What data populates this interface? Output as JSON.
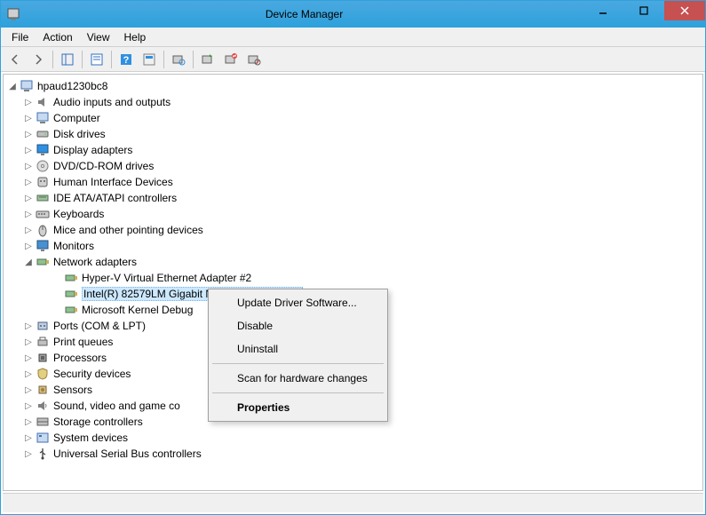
{
  "window": {
    "title": "Device Manager"
  },
  "menubar": {
    "items": [
      "File",
      "Action",
      "View",
      "Help"
    ]
  },
  "tree": {
    "root": "hpaud1230bc8",
    "categories": [
      {
        "label": "Audio inputs and outputs",
        "icon": "audio",
        "expanded": false
      },
      {
        "label": "Computer",
        "icon": "computer",
        "expanded": false
      },
      {
        "label": "Disk drives",
        "icon": "disk",
        "expanded": false
      },
      {
        "label": "Display adapters",
        "icon": "display",
        "expanded": false
      },
      {
        "label": "DVD/CD-ROM drives",
        "icon": "dvd",
        "expanded": false
      },
      {
        "label": "Human Interface Devices",
        "icon": "hid",
        "expanded": false
      },
      {
        "label": "IDE ATA/ATAPI controllers",
        "icon": "ide",
        "expanded": false
      },
      {
        "label": "Keyboards",
        "icon": "keyboard",
        "expanded": false
      },
      {
        "label": "Mice and other pointing devices",
        "icon": "mouse",
        "expanded": false
      },
      {
        "label": "Monitors",
        "icon": "monitor",
        "expanded": false
      },
      {
        "label": "Network adapters",
        "icon": "network",
        "expanded": true,
        "children": [
          {
            "label": "Hyper-V Virtual Ethernet Adapter #2",
            "icon": "network"
          },
          {
            "label": "Intel(R) 82579LM Gigabit Network Connection",
            "icon": "network",
            "selected": true
          },
          {
            "label": "Microsoft Kernel Debug",
            "icon": "network",
            "truncated": true
          }
        ]
      },
      {
        "label": "Ports (COM & LPT)",
        "icon": "port",
        "expanded": false
      },
      {
        "label": "Print queues",
        "icon": "printer",
        "expanded": false
      },
      {
        "label": "Processors",
        "icon": "cpu",
        "expanded": false
      },
      {
        "label": "Security devices",
        "icon": "security",
        "expanded": false
      },
      {
        "label": "Sensors",
        "icon": "sensor",
        "expanded": false
      },
      {
        "label": "Sound, video and game co",
        "icon": "sound",
        "expanded": false,
        "truncated": true
      },
      {
        "label": "Storage controllers",
        "icon": "storage",
        "expanded": false
      },
      {
        "label": "System devices",
        "icon": "system",
        "expanded": false
      },
      {
        "label": "Universal Serial Bus controllers",
        "icon": "usb",
        "expanded": false
      }
    ]
  },
  "context_menu": {
    "items": [
      {
        "label": "Update Driver Software...",
        "type": "item"
      },
      {
        "label": "Disable",
        "type": "item"
      },
      {
        "label": "Uninstall",
        "type": "item"
      },
      {
        "type": "separator"
      },
      {
        "label": "Scan for hardware changes",
        "type": "item"
      },
      {
        "type": "separator"
      },
      {
        "label": "Properties",
        "type": "item",
        "bold": true
      }
    ]
  }
}
